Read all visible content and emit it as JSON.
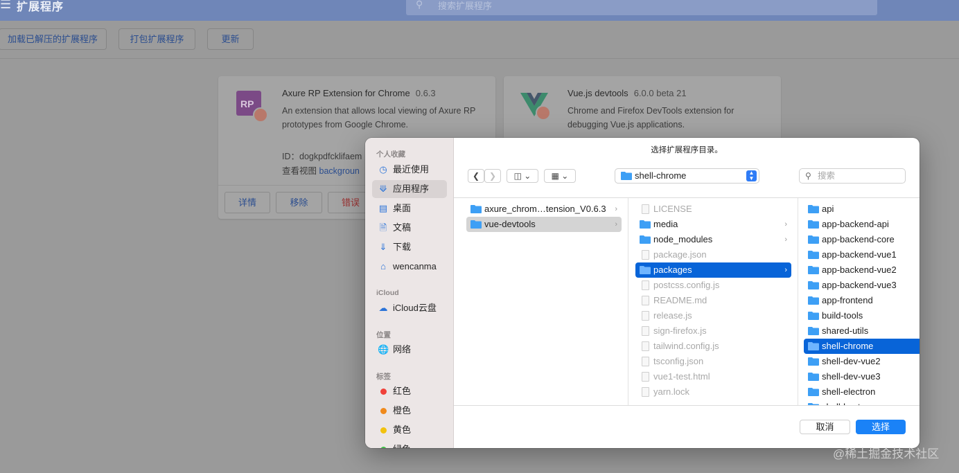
{
  "topbar": {
    "title": "扩展程序",
    "search_placeholder": "搜索扩展程序"
  },
  "toolbar": {
    "load_unpacked": "加载已解压的扩展程序",
    "pack": "打包扩展程序",
    "update": "更新"
  },
  "cards": [
    {
      "name": "Axure RP Extension for Chrome",
      "version": "0.6.3",
      "description": "An extension that allows local viewing of Axure RP prototypes from Google Chrome.",
      "id_line": "ID：dogkpdfcklifaem",
      "view_label": "查看视图",
      "view_link": "backgroun",
      "btn_details": "详情",
      "btn_remove": "移除",
      "btn_errors": "错误"
    },
    {
      "name": "Vue.js devtools",
      "version": "6.0.0 beta 21",
      "description": "Chrome and Firefox DevTools extension for debugging Vue.js applications."
    }
  ],
  "dialog": {
    "title": "选择扩展程序目录。",
    "path": "shell-chrome",
    "search_placeholder": "搜索",
    "cancel": "取消",
    "select": "选择",
    "sidebar": {
      "favorites_header": "个人收藏",
      "favorites": [
        "最近使用",
        "应用程序",
        "桌面",
        "文稿",
        "下载",
        "wencanma"
      ],
      "icloud_header": "iCloud",
      "icloud": [
        "iCloud云盘"
      ],
      "locations_header": "位置",
      "locations": [
        "网络"
      ],
      "tags_header": "标签",
      "tags": [
        "红色",
        "橙色",
        "黄色",
        "绿色"
      ]
    },
    "col1": [
      "axure_chrom…tension_V0.6.3",
      "vue-devtools"
    ],
    "col2": [
      "LICENSE",
      "media",
      "node_modules",
      "package.json",
      "packages",
      "postcss.config.js",
      "README.md",
      "release.js",
      "sign-firefox.js",
      "tailwind.config.js",
      "tsconfig.json",
      "vue1-test.html",
      "yarn.lock"
    ],
    "col3": [
      "api",
      "app-backend-api",
      "app-backend-core",
      "app-backend-vue1",
      "app-backend-vue2",
      "app-backend-vue3",
      "app-frontend",
      "build-tools",
      "shared-utils",
      "shell-chrome",
      "shell-dev-vue2",
      "shell-dev-vue3",
      "shell-electron",
      "shell-host"
    ]
  },
  "colors": {
    "accent": "#0864d8",
    "select_button": "#1a82f7",
    "folder": "#3d9ff5"
  },
  "watermark": "@稀土掘金技术社区"
}
